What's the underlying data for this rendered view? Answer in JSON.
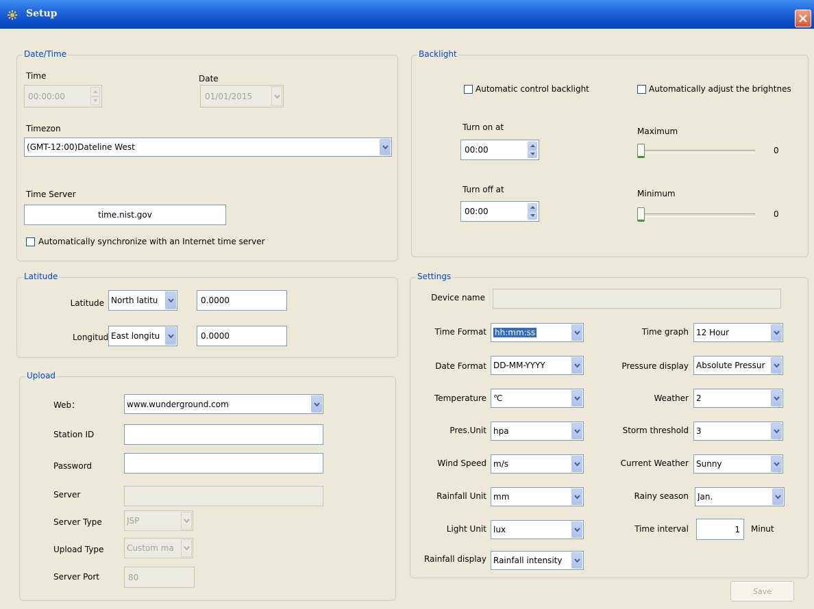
{
  "window": {
    "title": "Setup"
  },
  "datetime": {
    "legend": "Date/Time",
    "time_label": "Time",
    "time_value": "00:00:00",
    "date_label": "Date",
    "date_value": "01/01/2015",
    "timezone_label": "Timezon",
    "timezone_value": "(GMT-12:00)Dateline West",
    "server_label": "Time Server",
    "server_value": "time.nist.gov",
    "sync_label": "Automatically synchronize with an Internet time server",
    "sync_checked": false
  },
  "latitude": {
    "legend": "Latitude",
    "lat_label": "Latitude",
    "lat_dir": "North latitu",
    "lat_value": "0.0000",
    "lon_label": "Longitud",
    "lon_dir": "East longitu",
    "lon_value": "0.0000"
  },
  "upload": {
    "legend": "Upload",
    "web_label": "Web：",
    "web_value": "www.wunderground.com",
    "station_label": "Station ID",
    "station_value": "",
    "password_label": "Password",
    "password_value": "",
    "server_label": "Server",
    "server_value": "",
    "server_type_label": "Server Type",
    "server_type_value": "JSP",
    "upload_type_label": "Upload Type",
    "upload_type_value": "Custom ma",
    "port_label": "Server Port",
    "port_value": "80"
  },
  "backlight": {
    "legend": "Backlight",
    "auto_control_label": "Automatic control backlight",
    "auto_control_checked": false,
    "auto_bright_label": "Automatically adjust the brightnes",
    "auto_bright_checked": false,
    "on_label": "Turn on at",
    "on_value": "00:00",
    "off_label": "Turn off at",
    "off_value": "00:00",
    "max_label": "Maximum",
    "max_value": "0",
    "min_label": "Minimum",
    "min_value": "0"
  },
  "settings": {
    "legend": "Settings",
    "device_label": "Device name",
    "device_value": "",
    "time_format_label": "Time Format",
    "time_format_value": "hh:mm:ss",
    "date_format_label": "Date Format",
    "date_format_value": "DD-MM-YYYY",
    "temperature_label": "Temperature",
    "temperature_value": "℃",
    "pres_unit_label": "Pres.Unit",
    "pres_unit_value": "hpa",
    "wind_label": "Wind Speed",
    "wind_value": "m/s",
    "rain_unit_label": "Rainfall Unit",
    "rain_unit_value": "mm",
    "light_label": "Light Unit",
    "light_value": "lux",
    "rain_display_label": "Rainfall display",
    "rain_display_value": "Rainfall intensity",
    "time_graph_label": "Time graph",
    "time_graph_value": "12 Hour",
    "pressure_display_label": "Pressure display",
    "pressure_display_value": "Absolute Pressur",
    "weather_label": "Weather",
    "weather_value": "2",
    "storm_label": "Storm threshold",
    "storm_value": "3",
    "current_weather_label": "Current Weather",
    "current_weather_value": "Sunny",
    "rainy_label": "Rainy season",
    "rainy_value": "Jan.",
    "interval_label": "Time interval",
    "interval_value": "1",
    "interval_unit": "Minut"
  },
  "save_label": "Save"
}
